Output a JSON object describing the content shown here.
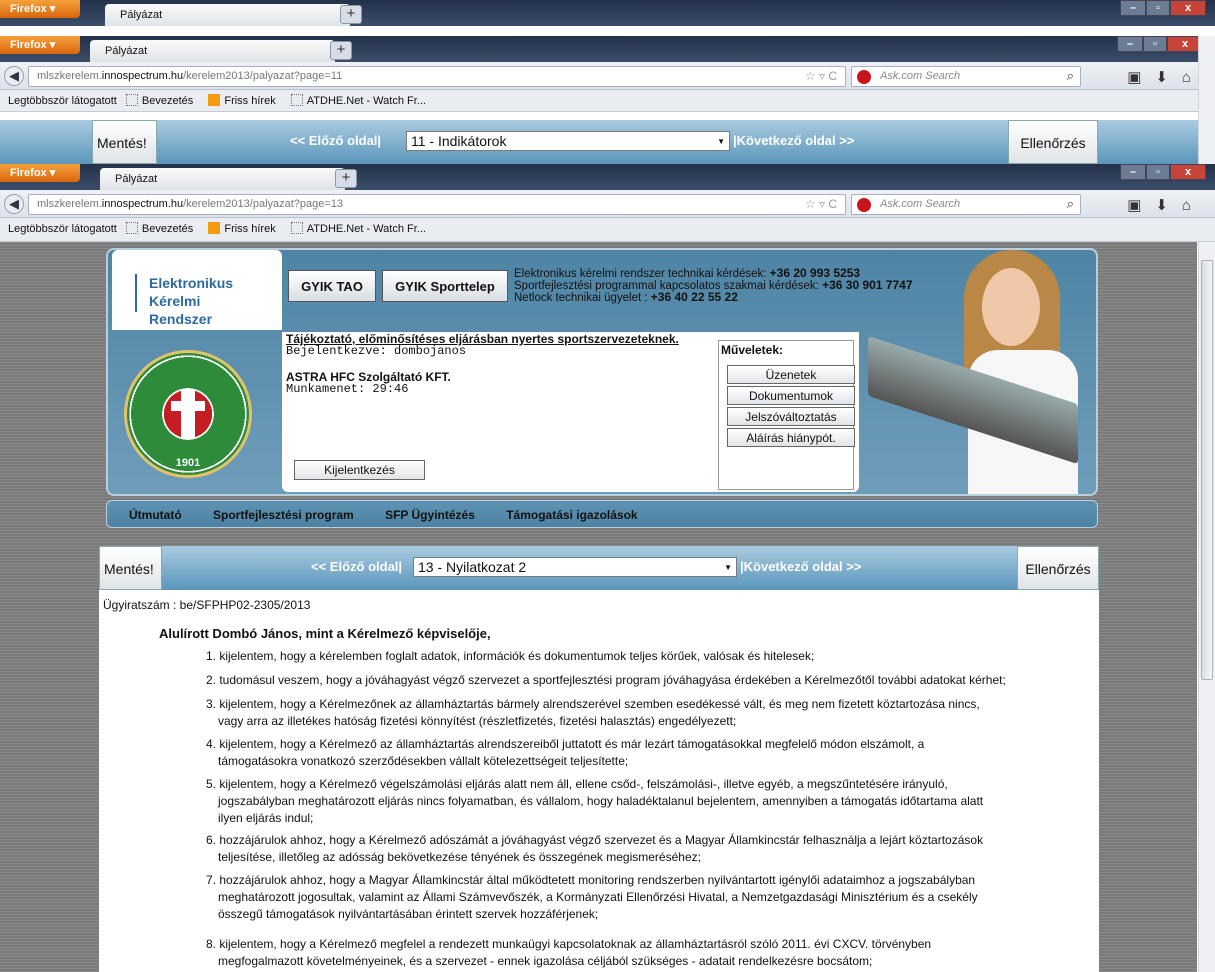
{
  "windows": [
    {
      "firefox_label": "Firefox",
      "tab_title": "Pályázat"
    },
    {
      "firefox_label": "Firefox",
      "tab_title": "Pályázat",
      "url_gray": "mlszkerelem.",
      "url_host": "innospectrum.hu",
      "url_path": "/kerelem2013/palyazat?page=11",
      "search_placeholder": "Ask.com Search"
    },
    {
      "firefox_label": "Firefox",
      "tab_title": "Pályázat",
      "url_gray": "mlszkerelem.",
      "url_host": "innospectrum.hu",
      "url_path": "/kerelem2013/palyazat?page=13",
      "search_placeholder": "Ask.com Search"
    }
  ],
  "bookmarks": [
    "Legtöbbször látogatott",
    "Bevezetés",
    "Friss hírek",
    "ATDHE.Net - Watch Fr..."
  ],
  "toolbar_top": {
    "save": "Mentés!",
    "prev": "<< Előző oldal|",
    "selected": "11 - Indikátorok",
    "next": "|Következő oldal >>",
    "check": "Ellenőrzés"
  },
  "header": {
    "logo_line1": "Elektronikus Kérelmi",
    "logo_line2": "Rendszer",
    "gyik_tao": "GYIK TAO",
    "gyik_sport": "GYIK Sporttelep",
    "contact1_label": "Elektronikus kérelmi rendszer technikai kérdések: ",
    "contact1_num": "+36 20 993 5253",
    "contact2_label": "Sportfejlesztési programmal kapcsolatos szakmai kérdések: ",
    "contact2_num": "+36 30 901 7747",
    "contact3_label": "Netlock technikai ügyelet : ",
    "contact3_num": "+36 40 22 55 22",
    "crest_year": "1901",
    "notice": "Tájékoztató, előminősítéses eljárásban nyertes sportszervezeteknek.",
    "login": "Bejelentkezve: dombojanos",
    "org": "ASTRA HFC Szolgáltató KFT.",
    "session": "Munkamenet: 29:46",
    "logout": "Kijelentkezés",
    "ops_title": "Műveletek:",
    "ops": [
      "Üzenetek",
      "Dokumentumok",
      "Jelszóváltoztatás",
      "Aláírás hiánypót."
    ]
  },
  "menu": [
    "Útmutató",
    "Sportfejlesztési program",
    "SFP Ügyintézés",
    "Támogatási igazolások"
  ],
  "toolbar": {
    "save": "Mentés!",
    "prev": "<< Előző oldal|",
    "selected": "13 - Nyilatkozat 2",
    "next": "|Következő oldal >>",
    "check": "Ellenőrzés"
  },
  "content": {
    "docno": "Ügyiratszám : be/SFPHP02-2305/2013",
    "heading": "Alulírott Dombó János, mint a Kérelmező képviselője,",
    "items": [
      [
        "1. kijelentem, hogy a kérelemben foglalt adatok, információk és dokumentumok teljes körűek, valósak és hitelesek;"
      ],
      [
        "2. tudomásul veszem, hogy a jóváhagyást végző szervezet a sportfejlesztési program jóváhagyása érdekében a Kérelmezőtől további adatokat kérhet;"
      ],
      [
        "3. kijelentem, hogy a Kérelmezőnek az államháztartás bármely alrendszerével szemben esedékessé vált, és meg nem fizetett köztartozása nincs,",
        "vagy arra az illetékes hatóság fizetési könnyítést (részletfizetés, fizetési halasztás) engedélyezett;"
      ],
      [
        "4. kijelentem, hogy a Kérelmező az államháztartás alrendszereiből juttatott és már lezárt támogatásokkal megfelelő módon elszámolt, a",
        "támogatásokra vonatkozó szerződésekben vállalt kötelezettségeit teljesítette;"
      ],
      [
        "5. kijelentem, hogy a Kérelmező végelszámolási eljárás alatt nem áll, ellene csőd-, felszámolási-, illetve egyéb, a megszűntetésére irányuló,",
        "jogszabályban meghatározott eljárás nincs folyamatban, és vállalom, hogy haladéktalanul bejelentem, amennyiben a támogatás időtartama alatt",
        "ilyen eljárás indul;"
      ],
      [
        "6. hozzájárulok ahhoz, hogy a Kérelmező adószámát a jóváhagyást végző szervezet és a Magyar Államkincstár felhasználja a lejárt köztartozások",
        "teljesítése, illetőleg az adósság bekövetkezése tényének és összegének megismeréséhez;"
      ],
      [
        "7. hozzájárulok ahhoz, hogy a Magyar Államkincstár által működtetett monitoring rendszerben nyilvántartott igénylői adataimhoz a jogszabályban",
        "meghatározott jogosultak, valamint az Állami Számvevőszék, a Kormányzati Ellenőrzési Hivatal, a Nemzetgazdasági Minisztérium és a csekély",
        "összegű támogatások nyilvántartásában érintett szervek hozzáférjenek;"
      ],
      [
        "8. kijelentem, hogy a Kérelmező megfelel a rendezett munkaügyi kapcsolatoknak az államháztartásról szóló 2011. évi CXCV. törvényben",
        "megfogalmazott követelményeinek, és a szervezet - ennek igazolása céljából szükséges - adatait rendelkezésre bocsátom;"
      ]
    ]
  }
}
